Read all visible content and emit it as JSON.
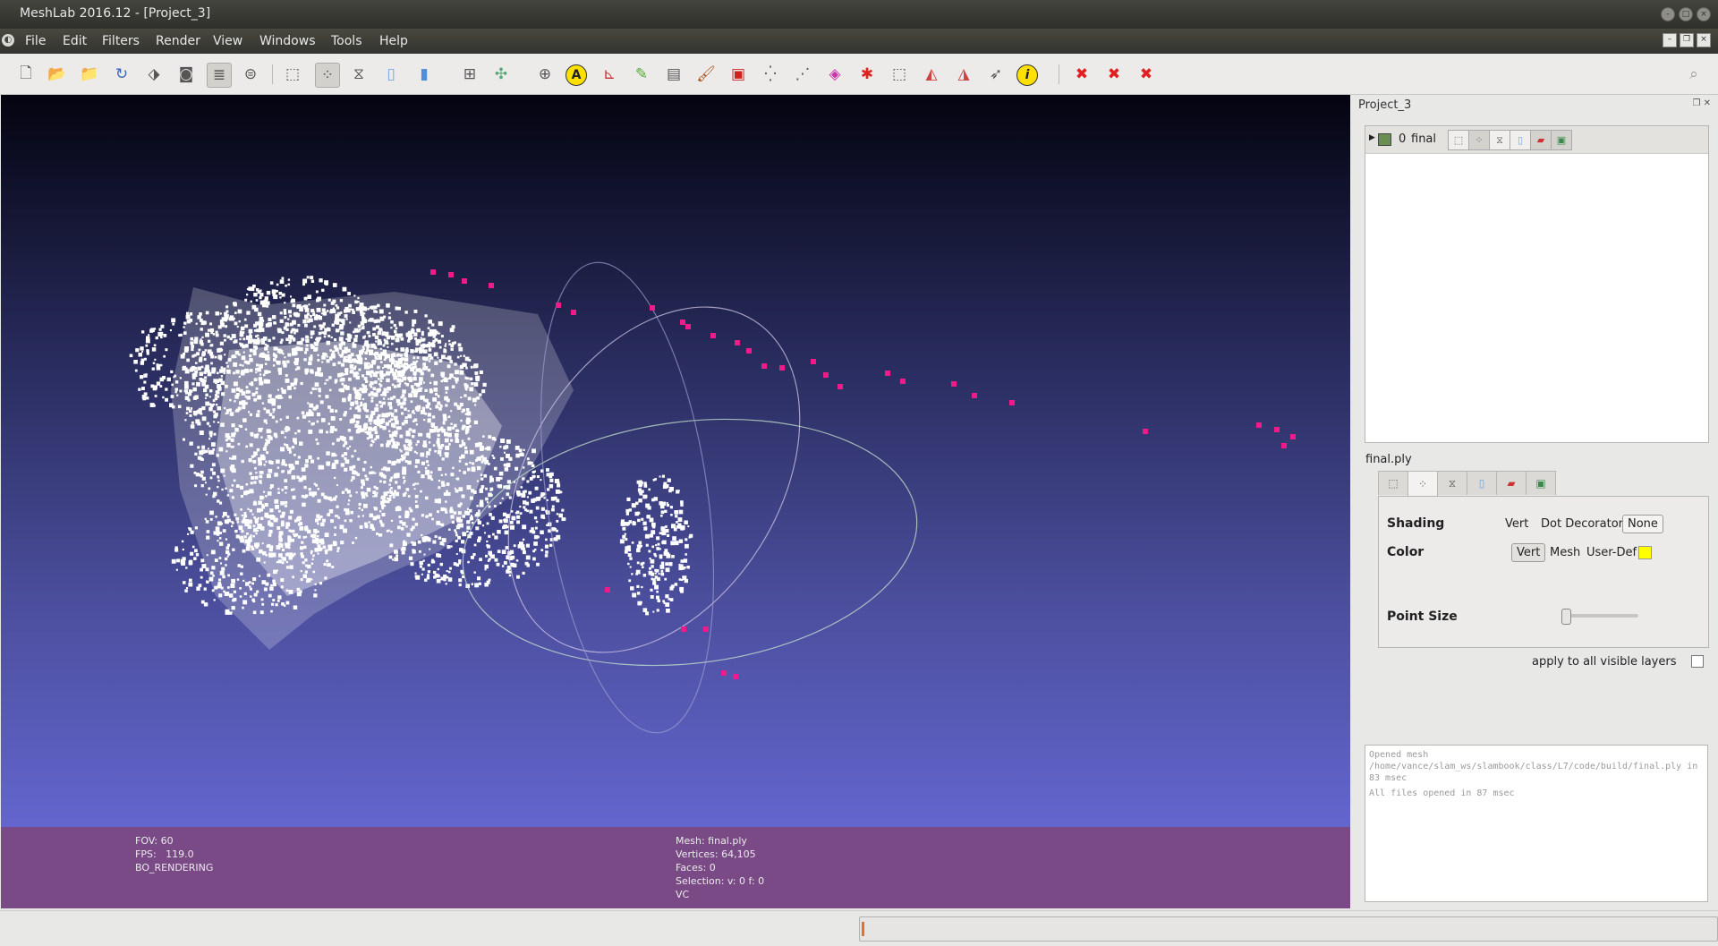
{
  "window": {
    "title": "MeshLab 2016.12 - [Project_3]"
  },
  "menu": [
    "File",
    "Edit",
    "Filters",
    "Render",
    "View",
    "Windows",
    "Tools",
    "Help"
  ],
  "toolbar": {
    "info_glyph": "i",
    "annotate_glyph": "A"
  },
  "viewport_info": {
    "left": [
      "FOV: 60",
      "FPS:   119.0",
      "BO_RENDERING"
    ],
    "mid": [
      "Mesh: final.ply",
      "Vertices: 64,105",
      "Faces: 0",
      "Selection: v: 0 f: 0",
      "VC"
    ]
  },
  "layers_panel": {
    "title": "Project_3",
    "layer": {
      "id": "0",
      "name": "final"
    }
  },
  "mesh_panel": {
    "mesh_name": "final.ply",
    "shading_label": "Shading",
    "shading_value": "Vert",
    "dot_decorator_label": "Dot Decorator",
    "dot_decorator_value": "None",
    "color_label": "Color",
    "color_options": [
      "Vert",
      "Mesh",
      "User-Def"
    ],
    "user_def_color": "#ffff00",
    "point_size_label": "Point Size",
    "point_size_level": 0,
    "apply_all_label": "apply to all visible layers"
  },
  "log": [
    "Opened mesh /home/vance/slam_ws/slambook/class/L7/code/build/final.ply in 83 msec",
    "All files opened in 87 msec"
  ],
  "colors": {
    "overlay": "#7a4a87",
    "camera_points": "#ee1b88",
    "progress": "#e2722a"
  }
}
